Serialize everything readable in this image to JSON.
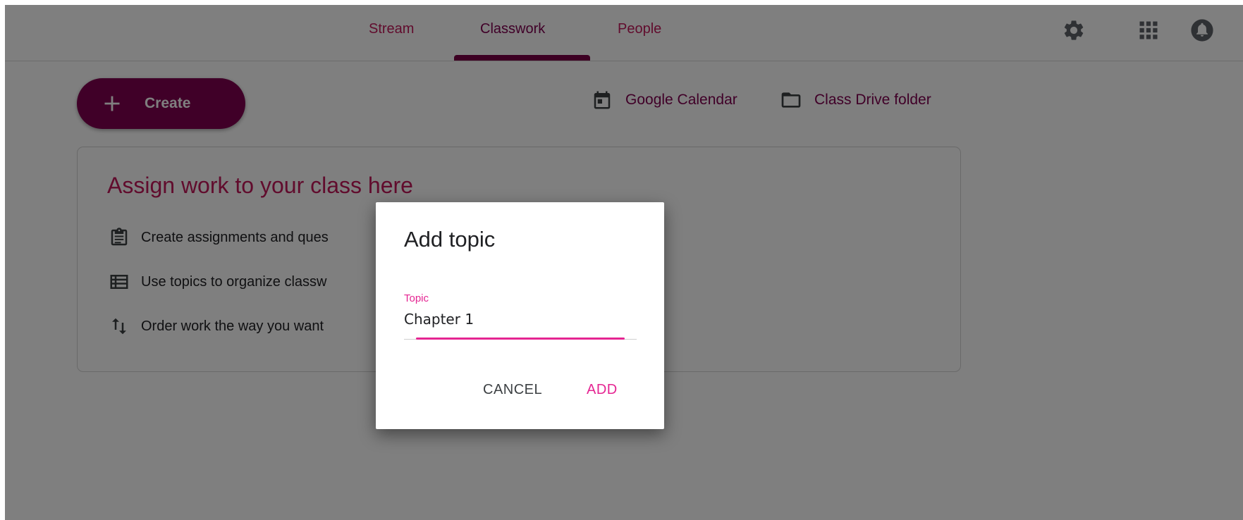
{
  "tabs": {
    "stream": "Stream",
    "classwork": "Classwork",
    "people": "People"
  },
  "header_icons": [
    "gear-icon",
    "apps-grid-icon",
    "notifications-icon"
  ],
  "create_button": {
    "label": "Create",
    "icon": "plus-icon"
  },
  "links": {
    "calendar": {
      "label": "Google Calendar",
      "icon": "calendar-icon"
    },
    "drive": {
      "label": "Class Drive folder",
      "icon": "folder-icon"
    }
  },
  "card": {
    "title": "Assign work to your class here",
    "items": [
      {
        "text": "Create assignments and ques",
        "icon": "clipboard-icon"
      },
      {
        "text": "Use topics to organize classw",
        "icon": "list-icon"
      },
      {
        "text": "Order work the way you want",
        "icon": "reorder-arrows-icon"
      }
    ]
  },
  "dialog": {
    "title": "Add topic",
    "field_label": "Topic",
    "field_value": "Chapter 1",
    "cancel_label": "CANCEL",
    "add_label": "ADD"
  },
  "colors": {
    "brand": "#800050",
    "accent": "#e52592",
    "tab_text": "#c2185b"
  }
}
